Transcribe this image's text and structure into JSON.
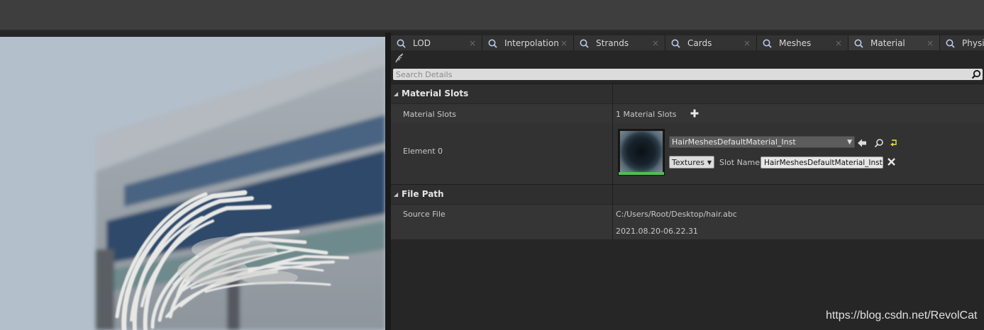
{
  "tabs": [
    {
      "label": "LOD",
      "icon": "details-icon",
      "active": false
    },
    {
      "label": "Interpolation",
      "icon": "details-icon",
      "active": false
    },
    {
      "label": "Strands",
      "icon": "details-icon",
      "active": false
    },
    {
      "label": "Cards",
      "icon": "details-icon",
      "active": false
    },
    {
      "label": "Meshes",
      "icon": "details-icon",
      "active": false
    },
    {
      "label": "Material",
      "icon": "details-icon",
      "active": true
    },
    {
      "label": "Physic",
      "icon": "details-icon",
      "active": false
    }
  ],
  "tab_close": "×",
  "search": {
    "placeholder": "Search Details"
  },
  "material_slots": {
    "category_label": "Material Slots",
    "slots_row_label": "Material Slots",
    "slots_count": "1 Material Slots",
    "element_label": "Element 0",
    "material_asset": "HairMeshesDefaultMaterial_Inst",
    "textures_label": "Textures",
    "slot_name_label": "Slot Name",
    "slot_name_value": "HairMeshesDefaultMaterial_Inst"
  },
  "file_path": {
    "category_label": "File Path",
    "source_file_label": "Source File",
    "source_file_path": "C:/Users/Root/Desktop/hair.abc",
    "source_file_date": "2021.08.20-06.22.31"
  },
  "watermark": "https://blog.csdn.net/RevolCat",
  "colors": {
    "panel_bg": "#262626",
    "category_bg": "#2f2f2f",
    "row_bg": "#353535",
    "thumb_accent": "#4fbf4f",
    "reset_arrow": "#e6e640"
  }
}
